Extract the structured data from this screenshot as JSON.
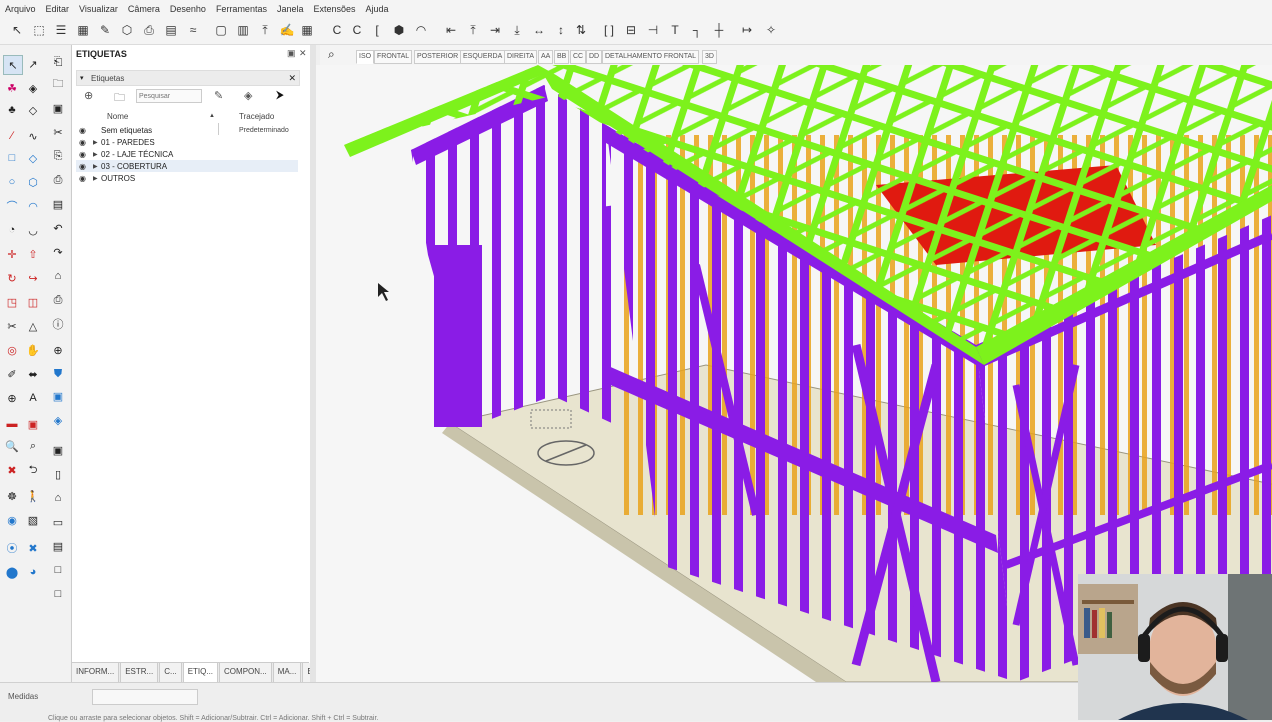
{
  "menu": [
    "Arquivo",
    "Editar",
    "Visualizar",
    "Câmera",
    "Desenho",
    "Ferramentas",
    "Janela",
    "Extensões",
    "Ajuda"
  ],
  "panel": {
    "title": "ETIQUETAS",
    "subheader": "Etiquetas",
    "search_placeholder": "Pesquisar",
    "col_name": "Nome",
    "col_style": "Tracejado",
    "rows": [
      {
        "label": "Sem etiquetas",
        "value": "Predeterminado"
      },
      {
        "label": "01 - PAREDES"
      },
      {
        "label": "02 - LAJE TÉCNICA"
      },
      {
        "label": "03 - COBERTURA"
      },
      {
        "label": "OUTROS"
      }
    ],
    "tabs": [
      "INFORM...",
      "ESTR...",
      "C...",
      "ETIQ...",
      "COMPON...",
      "MA...",
      "E..."
    ]
  },
  "scene_tabs": [
    "ISO",
    "FRONTAL",
    "POSTERIOR",
    "ESQUERDA",
    "DIREITA",
    "AA",
    "BB",
    "CC",
    "DD",
    "DETALHAMENTO FRONTAL",
    "3D"
  ],
  "status": {
    "measures_label": "Medidas",
    "hint": "Clique ou arraste para selecionar objetos. Shift = Adicionar/Subtrair. Ctrl = Adicionar. Shift + Ctrl = Subtrair."
  },
  "colors": {
    "wall_framing": "#8a1ce6",
    "roof_truss": "#7df21c",
    "inner_framing": "#e9a21a",
    "slab_highlight": "#e01a10",
    "floor": "#e8e4cf"
  }
}
